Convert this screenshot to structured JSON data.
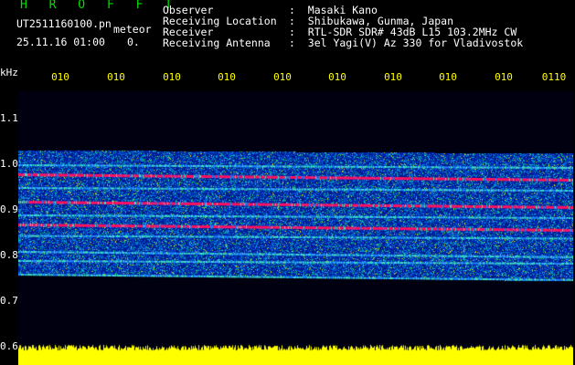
{
  "header": {
    "software": "H R O F F T",
    "filename": "UT2511160100.pn",
    "meteor_label": "meteor",
    "datetime": "25.11.16 01:00",
    "meteor_count": "0.",
    "info": [
      {
        "label": "Observer",
        "value": ":  Masaki Kano"
      },
      {
        "label": "Receiving Location",
        "value": ":  Shibukawa, Gunma, Japan"
      },
      {
        "label": "Receiver",
        "value": ":  RTL-SDR SDR# 43dB L15 103.2MHz CW"
      },
      {
        "label": "Receiving Antenna",
        "value": ":  3el Yagi(V) Az 330 for Vladivostok"
      }
    ]
  },
  "axis": {
    "y_unit": "kHz",
    "y_ticks": [
      "1.1",
      "1.0",
      "0.9",
      "0.8",
      "0.7",
      "0.6"
    ],
    "x_ticks": [
      "010",
      "010",
      "010",
      "010",
      "010",
      "010",
      "010",
      "010",
      "010",
      "0110"
    ]
  },
  "colors": {
    "background": "#000000",
    "text": "#ffffff",
    "title_green": "#00e000",
    "tick_yellow": "#ffff00",
    "noise_floor": "#001a8c",
    "signal_line": "#ff1060",
    "level_bar": "#ffff00"
  },
  "spectrogram": {
    "signal_lines_khz": [
      1.0,
      0.98,
      0.95,
      0.92,
      0.89,
      0.87,
      0.845,
      0.81,
      0.79,
      0.76
    ],
    "band_khz": [
      0.76,
      1.03
    ]
  }
}
